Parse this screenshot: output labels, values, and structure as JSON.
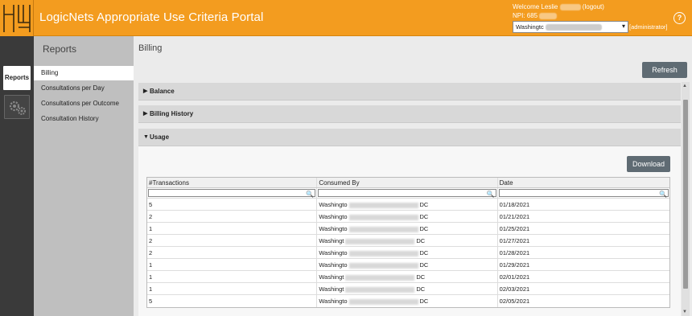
{
  "header": {
    "app_title": "LogicNets Appropriate Use Criteria Portal",
    "welcome_prefix": "Welcome Leslie",
    "logout_label": "(logout)",
    "npi_prefix": "NPI: 685",
    "facility_value": "Washingtc",
    "role_label": "[administrator]",
    "help_label": "?"
  },
  "rail": {
    "reports_label": "Reports"
  },
  "submenu": {
    "title": "Reports",
    "items": [
      {
        "label": "Billing"
      },
      {
        "label": "Consultations per Day"
      },
      {
        "label": "Consultations per Outcome"
      },
      {
        "label": "Consultation History"
      }
    ]
  },
  "main": {
    "page_title": "Billing",
    "refresh_label": "Refresh",
    "sections": {
      "balance": "Balance",
      "billing_history": "Billing History",
      "usage": "Usage"
    },
    "download_label": "Download"
  },
  "table": {
    "columns": [
      "#Transactions",
      "Consumed By",
      "Date"
    ],
    "rows": [
      {
        "transactions": "5",
        "consumed_prefix": "Washingto",
        "consumed_suffix": "DC",
        "date": "01/18/2021"
      },
      {
        "transactions": "2",
        "consumed_prefix": "Washingto",
        "consumed_suffix": "DC",
        "date": "01/21/2021"
      },
      {
        "transactions": "1",
        "consumed_prefix": "Washingto",
        "consumed_suffix": "DC",
        "date": "01/25/2021"
      },
      {
        "transactions": "2",
        "consumed_prefix": "Washingt",
        "consumed_suffix": "DC",
        "date": "01/27/2021"
      },
      {
        "transactions": "2",
        "consumed_prefix": "Washingto",
        "consumed_suffix": "DC",
        "date": "01/28/2021"
      },
      {
        "transactions": "1",
        "consumed_prefix": "Washingto",
        "consumed_suffix": "DC",
        "date": "01/29/2021"
      },
      {
        "transactions": "1",
        "consumed_prefix": "Washingt",
        "consumed_suffix": "DC",
        "date": "02/01/2021"
      },
      {
        "transactions": "1",
        "consumed_prefix": "Washingt",
        "consumed_suffix": "DC",
        "date": "02/03/2021"
      },
      {
        "transactions": "5",
        "consumed_prefix": "Washingto",
        "consumed_suffix": "DC",
        "date": "02/05/2021"
      }
    ]
  },
  "colors": {
    "header_bg": "#f39c1f",
    "rail_bg": "#3a3a3a",
    "submenu_bg": "#bfbfbf",
    "button_bg": "#5f6b73"
  }
}
